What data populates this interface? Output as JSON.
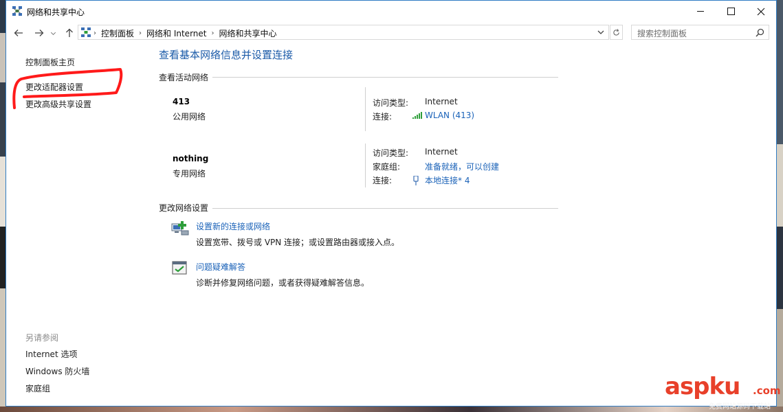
{
  "window": {
    "title": "网络和共享中心"
  },
  "address": {
    "crumbs": [
      "控制面板",
      "网络和 Internet",
      "网络和共享中心"
    ],
    "search_placeholder": "搜索控制面板"
  },
  "sidebar": {
    "home": "控制面板主页",
    "adapter": "更改适配器设置",
    "sharing": "更改高级共享设置",
    "see_also_header": "另请参阅",
    "see_also": [
      "Internet 选项",
      "Windows 防火墙",
      "家庭组"
    ]
  },
  "main": {
    "title": "查看基本网络信息并设置连接",
    "active_header": "查看活动网络",
    "networks": [
      {
        "name": "413",
        "type": "公用网络",
        "rows": [
          {
            "label": "访问类型:",
            "value": "Internet",
            "link": false
          },
          {
            "label": "连接:",
            "value": "WLAN (413)",
            "link": true,
            "icon": "wifi-signal-icon"
          }
        ]
      },
      {
        "name": "nothing",
        "type": "专用网络",
        "rows": [
          {
            "label": "访问类型:",
            "value": "Internet",
            "link": false
          },
          {
            "label": "家庭组:",
            "value": "准备就绪，可以创建",
            "link": true
          },
          {
            "label": "连接:",
            "value": "本地连接* 4",
            "link": true,
            "icon": "ethernet-adapter-icon"
          }
        ]
      }
    ],
    "change_header": "更改网络设置",
    "tasks": [
      {
        "link": "设置新的连接或网络",
        "desc": "设置宽带、拨号或 VPN 连接；或设置路由器或接入点。",
        "icon": "new-connection-icon"
      },
      {
        "link": "问题疑难解答",
        "desc": "诊断并修复网络问题，或者获得疑难解答信息。",
        "icon": "troubleshoot-icon"
      }
    ]
  },
  "watermark": {
    "brand": "aspku",
    "tld": ".com",
    "sub": "免费网站源码下载站"
  },
  "colors": {
    "link": "#1a62b8",
    "title": "#1a5aa8",
    "annotation": "#ff1a1a",
    "signal": "#2e9e3a"
  }
}
